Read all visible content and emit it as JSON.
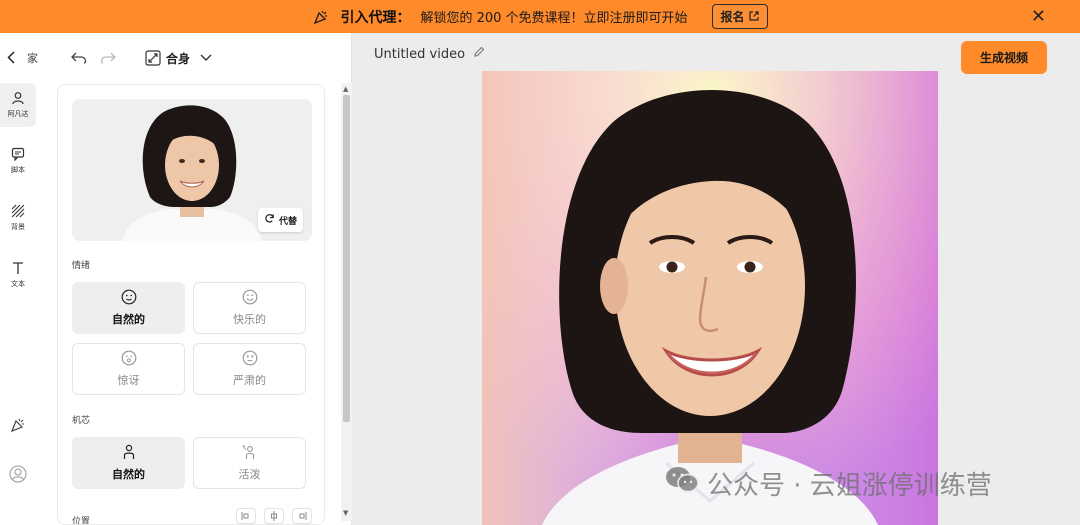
{
  "banner": {
    "title": "引入代理：",
    "message": "解锁您的 200 个免费课程！立即注册即可开始",
    "register_label": "报名"
  },
  "rail": {
    "items": [
      {
        "label": "阿凡达"
      },
      {
        "label": "脚本"
      },
      {
        "label": "背景"
      },
      {
        "label": "文本"
      }
    ]
  },
  "toolbar": {
    "home_label": "家",
    "fit_label": "合身"
  },
  "avatar": {
    "replace_label": "代替"
  },
  "emotion": {
    "label": "情绪",
    "options": [
      {
        "label": "自然的",
        "selected": true
      },
      {
        "label": "快乐的",
        "selected": false
      },
      {
        "label": "惊讶",
        "selected": false
      },
      {
        "label": "严肃的",
        "selected": false
      }
    ]
  },
  "motion": {
    "label": "机芯",
    "options": [
      {
        "label": "自然的",
        "selected": true
      },
      {
        "label": "活泼",
        "selected": false
      }
    ]
  },
  "position": {
    "label": "位置"
  },
  "main": {
    "video_title": "Untitled video",
    "generate_label": "生成视频",
    "watermark": "公众号 · 云姐涨停训练营"
  },
  "colors": {
    "accent": "#ff8a2a"
  }
}
